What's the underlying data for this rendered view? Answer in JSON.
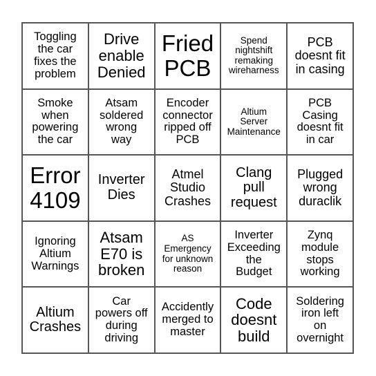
{
  "card": {
    "cells": [
      {
        "text": "Toggling\nthe car\nfixes the\nproblem",
        "size": "s16"
      },
      {
        "text": "Drive\nenable\nDenied",
        "size": "s22"
      },
      {
        "text": "Fried\nPCB",
        "size": "s32"
      },
      {
        "text": "Spend\nnightshift\nremaking\nwireharness",
        "size": "s13"
      },
      {
        "text": "PCB\ndoesnt fit\nin casing",
        "size": "s18"
      },
      {
        "text": "Smoke\nwhen\npowering\nthe car",
        "size": "s16"
      },
      {
        "text": "Atsam\nsoldered\nwrong\nway",
        "size": "s16"
      },
      {
        "text": "Encoder\nconnector\nripped off\nPCB",
        "size": "s16"
      },
      {
        "text": "Altium\nServer\nMaintenance",
        "size": "s13"
      },
      {
        "text": "PCB\nCasing\ndoesnt fit\nin car",
        "size": "s16"
      },
      {
        "text": "Error\n4109",
        "size": "s32"
      },
      {
        "text": "Inverter\nDies",
        "size": "s20"
      },
      {
        "text": "Atmel\nStudio\nCrashes",
        "size": "s18"
      },
      {
        "text": "Clang\npull\nrequest",
        "size": "s20"
      },
      {
        "text": "Plugged\nwrong\nduraclik",
        "size": "s18"
      },
      {
        "text": "Ignoring\nAltium\nWarnings",
        "size": "s16"
      },
      {
        "text": "Atsam\nE70 is\nbroken",
        "size": "s22"
      },
      {
        "text": "AS\nEmergency\nfor unknown\nreason",
        "size": "s13"
      },
      {
        "text": "Inverter\nExceeding\nthe\nBudget",
        "size": "s16"
      },
      {
        "text": "Zynq\nmodule\nstops\nworking",
        "size": "s16"
      },
      {
        "text": "Altium\nCrashes",
        "size": "s20"
      },
      {
        "text": "Car\npowers off\nduring\ndriving",
        "size": "s16"
      },
      {
        "text": "Accidently\nmerged to\nmaster",
        "size": "s16"
      },
      {
        "text": "Code\ndoesnt\nbuild",
        "size": "s22"
      },
      {
        "text": "Soldering\niron left\non\novernight",
        "size": "s16"
      }
    ]
  }
}
